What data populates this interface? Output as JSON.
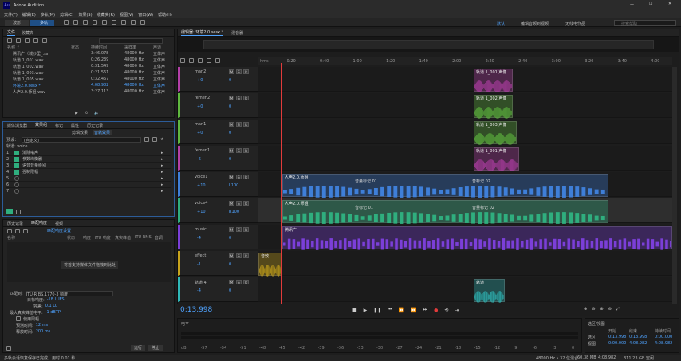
{
  "window": {
    "title": "Adobe Audition"
  },
  "menu": [
    "文件(F)",
    "编辑(E)",
    "多轨(M)",
    "剪辑(C)",
    "效果(S)",
    "收藏夹(R)",
    "视图(V)",
    "窗口(W)",
    "帮助(H)"
  ],
  "toolbar": {
    "wave_label": "波形",
    "multi_label": "多轨",
    "workspace": [
      "默认",
      "编辑音频到视频",
      "无线电作品"
    ],
    "search_placeholder": "搜索帮助"
  },
  "files_panel": {
    "tabs": [
      "文件",
      "收藏夹"
    ],
    "columns": [
      "名称 ↑",
      "状态",
      "持续时间",
      "采样率",
      "声道"
    ],
    "rows": [
      [
        "腾讯广（城沙里_.ss",
        "",
        "3:46.078",
        "48000 Hz",
        "立体声"
      ],
      [
        "轨道 1_001.wav",
        "",
        "0:26.239",
        "48000 Hz",
        "立体声"
      ],
      [
        "轨道 1_002.wav",
        "",
        "0:31.549",
        "48000 Hz",
        "立体声"
      ],
      [
        "轨道 1_003.wav",
        "",
        "0:21.561",
        "48000 Hz",
        "立体声"
      ],
      [
        "轨道 1_005.wav",
        "",
        "0:32.467",
        "48000 Hz",
        "立体声"
      ],
      [
        "环境2.0.sesx *",
        "",
        "4:08.982",
        "48000 Hz",
        "立体声"
      ],
      [
        "人声2.0.师姐.wav",
        "",
        "3:27.113",
        "48000 Hz",
        "立体声"
      ]
    ]
  },
  "effects_panel": {
    "tabs": [
      "媒体浏览器",
      "效果组",
      "标记",
      "属性",
      "历史记录"
    ],
    "subtabs": [
      "剪辑效果",
      "音轨效果"
    ],
    "preset_label": "预设：",
    "preset_value": "(自定义)",
    "track_label": "轨道: voice",
    "items": [
      "1",
      "2",
      "3",
      "4",
      "5",
      "6",
      "7"
    ],
    "effects": [
      "消除嗡声",
      "参数均衡器",
      "语音音量级别",
      "强制限幅"
    ]
  },
  "loudness_panel": {
    "tabs": [
      "历史记录",
      "匹配响度",
      "视频"
    ],
    "button": "匹配响度设置",
    "columns": [
      "名称",
      "状态",
      "响度",
      "ITU 响度",
      "真实峰值",
      "ITU RMS",
      "音调"
    ],
    "drop_hint": "将首支持媒体文件拖拽到此处",
    "match_label": "匹配到:",
    "match_value": "ITU-R BS.1770-3 响度",
    "target_label": "目标响度:",
    "target_value": "-18 LUFS",
    "tolerance_label": "容差:",
    "tolerance_value": "0.1 LU",
    "peak_label": "最大真实峰值电平:",
    "peak_value": "-1 dBTP",
    "limiter": "使用限幅",
    "lookahead_label": "预测时间:",
    "lookahead_value": "12 ms",
    "release_label": "释放时间:",
    "release_value": "200 ms",
    "apply": "运行",
    "cancel": "停止"
  },
  "editor": {
    "tabs": [
      "编辑器: 环境2.0.sesx *",
      "混音器"
    ],
    "time_display": "0:13.998",
    "ruler_unit": "hms",
    "ruler": [
      "0:20",
      "0:40",
      "1:00",
      "1:20",
      "1:40",
      "2:00",
      "2:20",
      "2:40",
      "3:00",
      "3:20",
      "3:40",
      "4:00"
    ],
    "tracks": [
      {
        "name": "man2",
        "vol": "+0",
        "pan": "0",
        "color": "#b43fa8"
      },
      {
        "name": "femen2",
        "vol": "+0",
        "pan": "0",
        "color": "#5fb83f"
      },
      {
        "name": "man1",
        "vol": "+0",
        "pan": "0",
        "color": "#5fb83f"
      },
      {
        "name": "femen1",
        "vol": "-6",
        "pan": "0",
        "color": "#b43fa8"
      },
      {
        "name": "voice1",
        "vol": "+10",
        "pan": "L100",
        "color": "#3f7fd8"
      },
      {
        "name": "voice4",
        "vol": "+10",
        "pan": "R100",
        "color": "#2fae7e"
      },
      {
        "name": "music",
        "vol": "-4",
        "pan": "0",
        "color": "#7b3fd8"
      },
      {
        "name": "effect",
        "vol": "-1",
        "pan": "0",
        "color": "#c8a41c"
      },
      {
        "name": "轨道 4",
        "vol": "-4",
        "pan": "0",
        "color": "#2fb8b8"
      },
      {
        "name": "混合",
        "vol": "",
        "pan": "",
        "color": "#555"
      }
    ],
    "clips": {
      "c1": "轨道 1_001  声像",
      "c2": "轨道 1_002  声像",
      "c3": "轨道 1_003  声像",
      "c4": "轨道 1_001  声像",
      "v1": "人声2.0.师姐",
      "v1m": "音量标记 01",
      "v1n": "音标记 02",
      "v2": "人声2.0.师姐",
      "v2m": "音标记 01",
      "v2n": "音量标记 02",
      "mus": "腾讯广",
      "fx": "音效",
      "t4": "轨道"
    }
  },
  "meters": {
    "title": "电平",
    "scale": [
      "dB",
      "-57",
      "-54",
      "-51",
      "-48",
      "-45",
      "-42",
      "-39",
      "-36",
      "-33",
      "-30",
      "-27",
      "-24",
      "-21",
      "-18",
      "-15",
      "-12",
      "-9",
      "-6",
      "-3",
      "0"
    ]
  },
  "selection": {
    "title": "选区/视图",
    "cols": [
      "开始",
      "结束",
      "持续时间"
    ],
    "rows": [
      [
        "选区",
        "0:13.998",
        "0:13.998",
        "0:00.000"
      ],
      [
        "视图",
        "0:00.000",
        "4:08.982",
        "4:08.982"
      ]
    ]
  },
  "status": {
    "left": "多轨会话恢复保存已完成，用时 0.01 秒",
    "right": [
      "48000 Hz • 32 位混合",
      "60.38 MB",
      "4:08.982",
      "311.23 GB 空闲"
    ]
  }
}
